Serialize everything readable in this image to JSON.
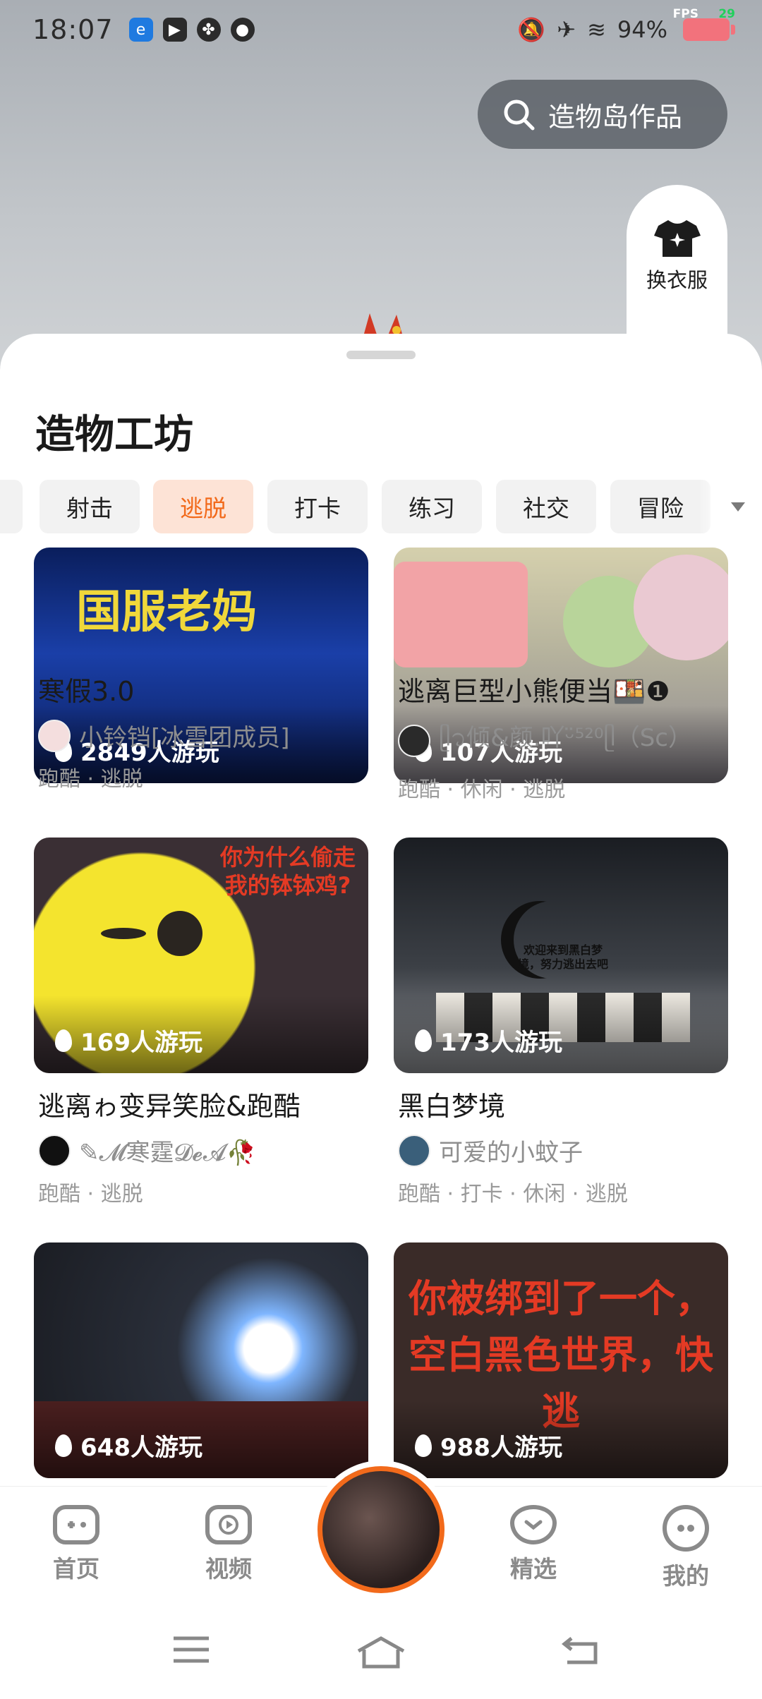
{
  "status_bar": {
    "time": "18:07",
    "battery": "94%",
    "fps_label": "FPS",
    "fps_value": "29"
  },
  "search": {
    "label": "造物岛作品"
  },
  "side_tool": {
    "label": "换衣服"
  },
  "section": {
    "title": "造物工坊"
  },
  "tabs": [
    {
      "label": "射击",
      "active": false
    },
    {
      "label": "逃脱",
      "active": true
    },
    {
      "label": "打卡",
      "active": false
    },
    {
      "label": "练习",
      "active": false
    },
    {
      "label": "社交",
      "active": false
    },
    {
      "label": "冒险",
      "active": false
    }
  ],
  "cards": [
    {
      "plays": "2849人游玩",
      "title": "寒假3.0",
      "author": "小铃铛[冰雪团成员]",
      "tags": "跑酷 · 逃脱",
      "thumb_text": "国服老妈"
    },
    {
      "plays": "107人游玩",
      "title": "逃离巨型小熊便当🍱❶",
      "author": "ᥫ᭡倾&颜.吖ᵕ̈⁵²⁰ᥫ（Sc）",
      "tags": "跑酷 · 休闲 · 逃脱"
    },
    {
      "plays": "169人游玩",
      "title": "逃离ゎ变异笑脸&跑酷",
      "author": "✎𝓜寒霆𝓓𝓮𝓐🥀",
      "tags": "跑酷 · 逃脱",
      "thumb_text": "你为什么偷走我的钵钵鸡?"
    },
    {
      "plays": "173人游玩",
      "title": "黑白梦境",
      "author": "可爱的小蚊子",
      "tags": "跑酷 · 打卡 · 休闲 · 逃脱",
      "thumb_text": "欢迎来到黑白梦境，努力逃出去吧"
    },
    {
      "plays": "648人游玩",
      "title": "",
      "author": "",
      "tags": ""
    },
    {
      "plays": "988人游玩",
      "title": "",
      "author": "",
      "tags": "",
      "thumb_text": "你被绑到了一个，空白黑色世界，快逃"
    }
  ],
  "bottom_nav": {
    "home": "首页",
    "video": "视频",
    "featured": "精选",
    "mine": "我的"
  },
  "colors": {
    "accent": "#f26a1b",
    "active_tab_bg": "#fde3d6"
  }
}
